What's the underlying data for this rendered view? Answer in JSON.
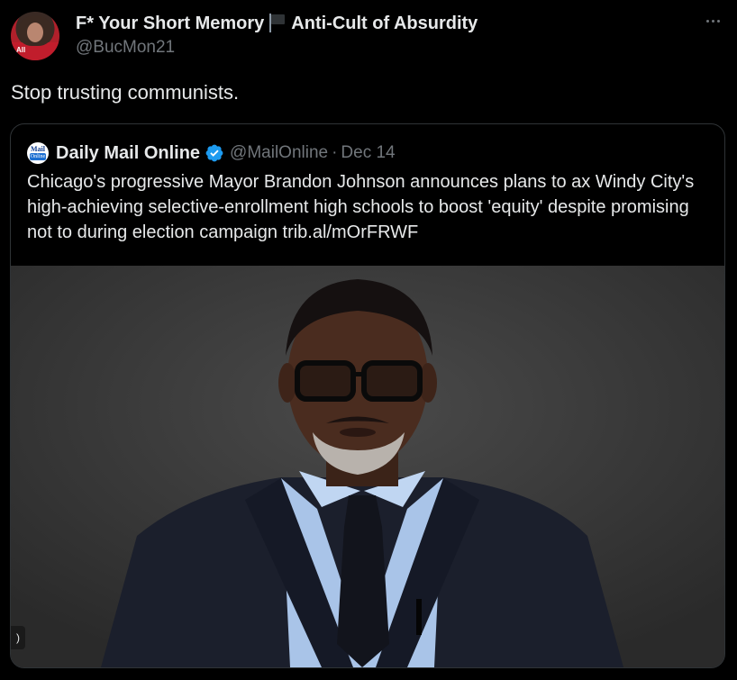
{
  "author": {
    "display_name_part1": "F* Your Short Memory",
    "display_name_part2": "Anti-Cult of Absurdity",
    "handle": "@BucMon21",
    "avatar_tag": "All"
  },
  "tweet": {
    "text": "Stop trusting communists."
  },
  "quoted_tweet": {
    "name": "Daily Mail Online",
    "logo_line1": "Mail",
    "logo_line2": "Online",
    "handle": "@MailOnline",
    "separator": "·",
    "date": "Dec 14",
    "text": "Chicago's progressive Mayor Brandon Johnson announces plans to ax Windy City's high-achieving selective-enrollment high schools to boost 'equity' despite promising not to during election campaign trib.al/mOrFRWF",
    "media": "photo of man with glasses and grey beard in dark suit and blue shirt"
  },
  "icons": {
    "more": "more-horizontal-icon",
    "flag": "black-flag-icon",
    "verified": "verified-badge-icon",
    "sound": "sound-icon"
  },
  "colors": {
    "background": "#000000",
    "text": "#e7e9ea",
    "secondary": "#71767b",
    "border": "#2f3336",
    "verified": "#1d9bf0"
  }
}
